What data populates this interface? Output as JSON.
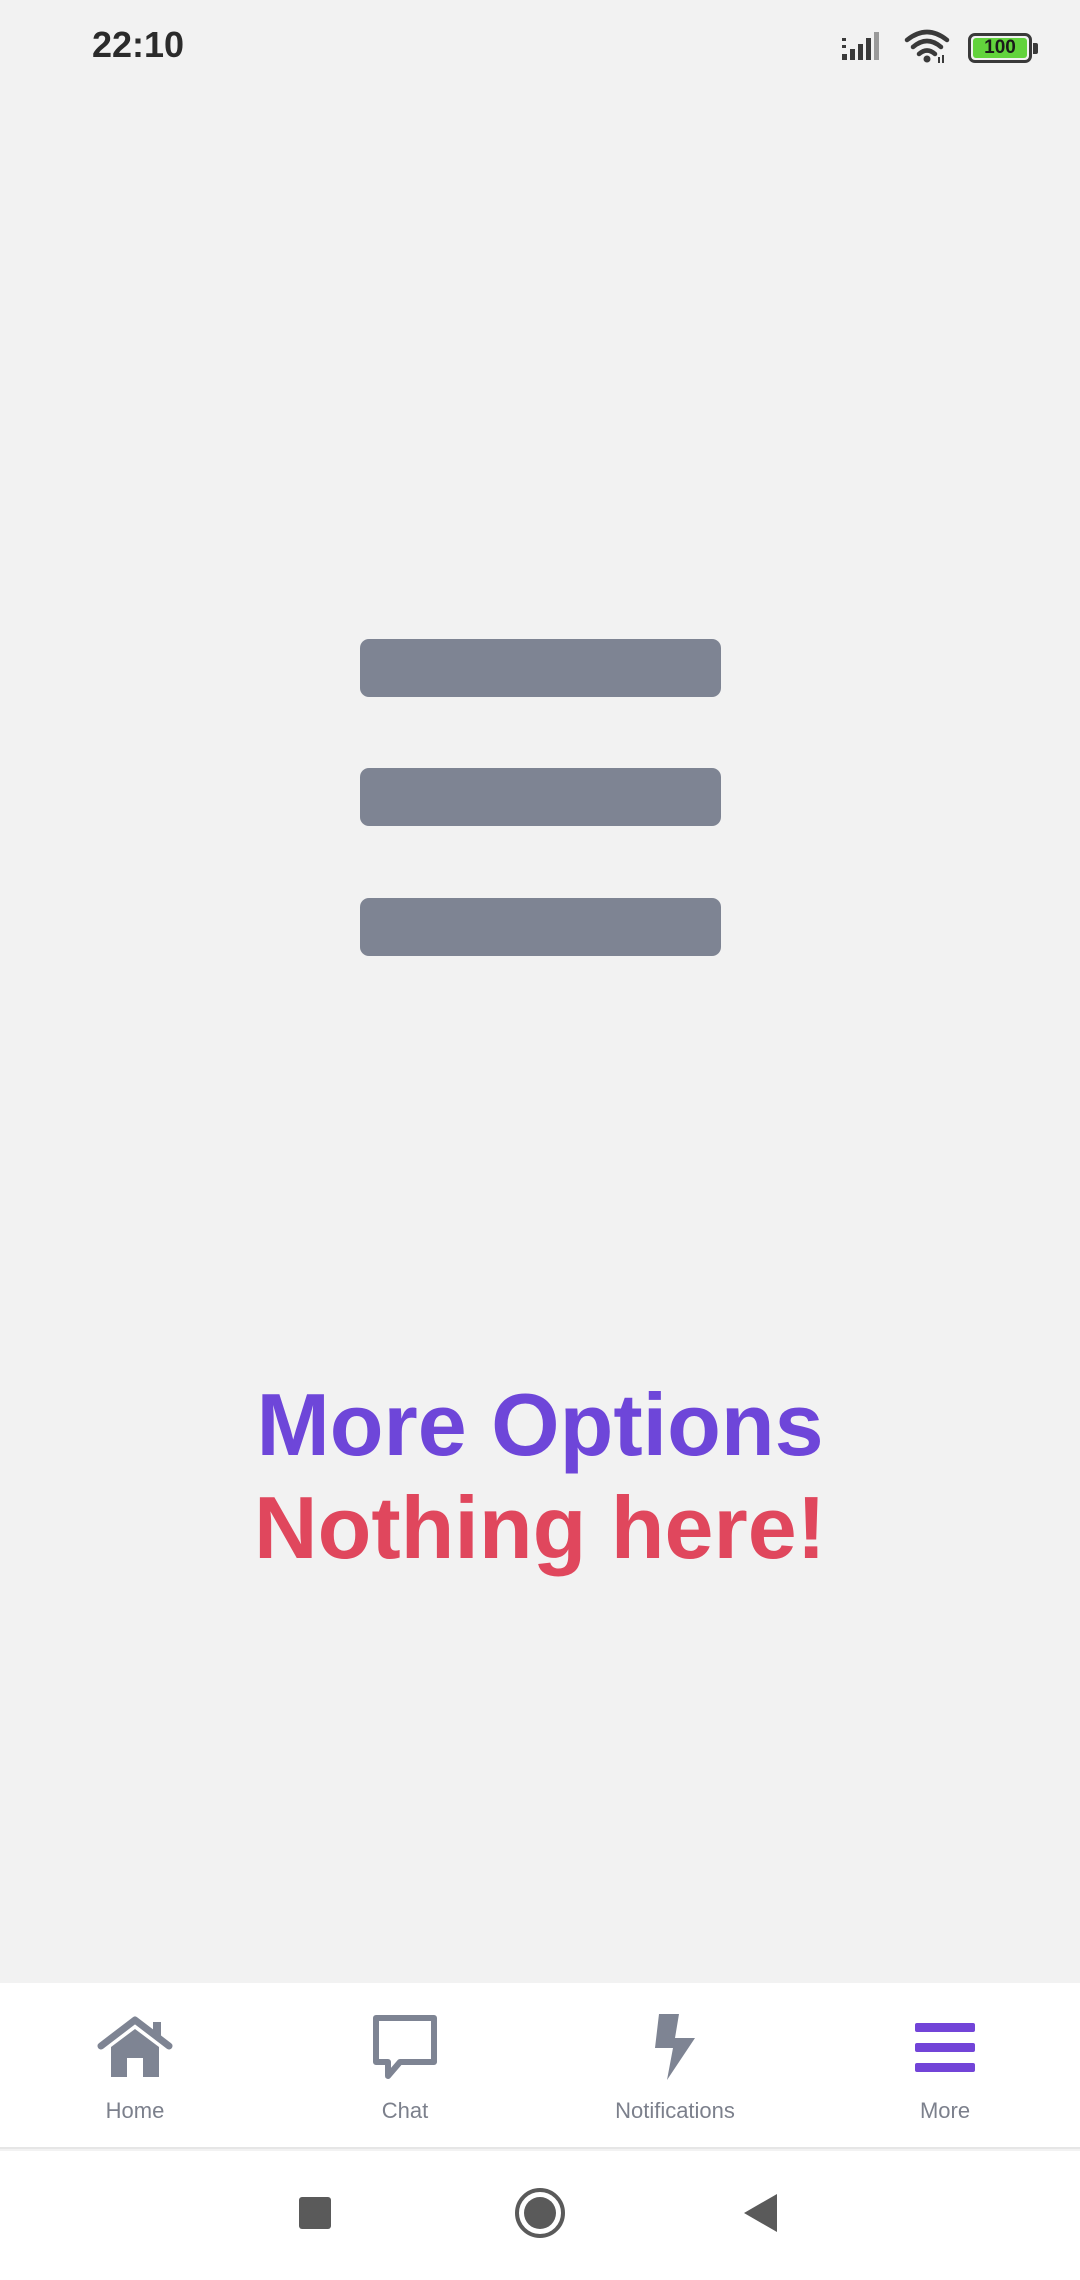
{
  "status_bar": {
    "time": "22:10",
    "battery_level": "100",
    "icons": [
      "signal-icon",
      "wifi-icon",
      "battery-icon"
    ]
  },
  "main": {
    "illustration_icon": "menu-icon",
    "title": "More Options",
    "subtitle": "Nothing here!"
  },
  "bottom_nav": {
    "items": [
      {
        "label": "Home",
        "icon": "home-icon",
        "active": false
      },
      {
        "label": "Chat",
        "icon": "chat-icon",
        "active": false
      },
      {
        "label": "Notifications",
        "icon": "bolt-icon",
        "active": false
      },
      {
        "label": "More",
        "icon": "menu-icon",
        "active": true
      }
    ]
  },
  "system_nav": {
    "buttons": [
      "recents-button",
      "home-button",
      "back-button"
    ]
  },
  "colors": {
    "background": "#f2f2f2",
    "title": "#6e46d9",
    "subtitle": "#e0475d",
    "icon_inactive": "#7e8493",
    "icon_active": "#7244d8",
    "battery": "#62d33c"
  }
}
